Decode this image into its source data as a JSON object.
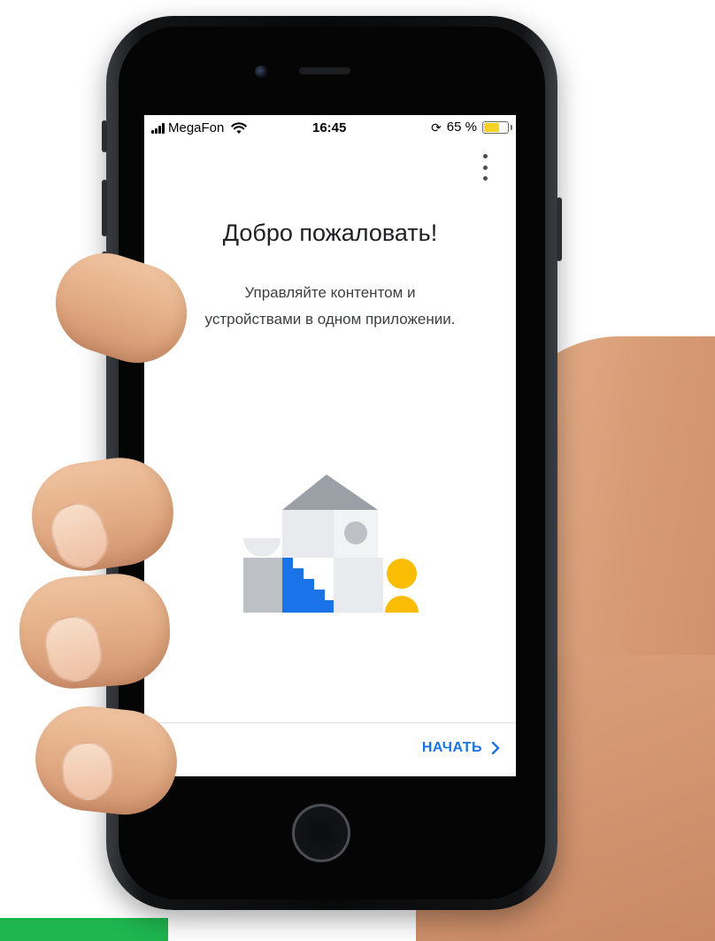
{
  "status_bar": {
    "carrier": "MegaFon",
    "time": "16:45",
    "battery_percent_label": "65 %",
    "battery_level": 0.65,
    "battery_color": "#f6d224",
    "icons": [
      "signal-icon",
      "wifi-icon",
      "rotation-lock-icon",
      "battery-icon"
    ]
  },
  "toolbar": {
    "menu_icon": "more-vert-icon"
  },
  "welcome": {
    "title": "Добро пожаловать!",
    "subtitle": "Управляйте контентом и устройствами в одном приложении."
  },
  "footer": {
    "start_label": "НАЧАТЬ",
    "start_icon": "chevron-right-icon"
  },
  "colors": {
    "accent": "#1a73e8",
    "illustration_blue": "#1a73e8",
    "illustration_yellow": "#fbbc04",
    "illustration_gray": "#bdc1c6",
    "illustration_light": "#e8eaed",
    "background_green_strip": "#1fb54f"
  }
}
